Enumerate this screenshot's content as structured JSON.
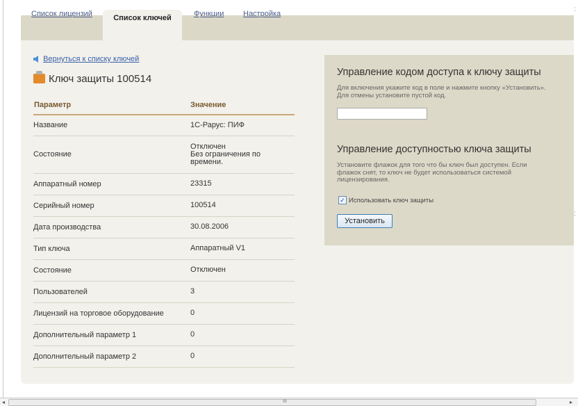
{
  "tabs": [
    {
      "label": "Список лицензий",
      "active": false
    },
    {
      "label": "Список ключей",
      "active": true
    },
    {
      "label": "Функции",
      "active": false
    },
    {
      "label": "Настройка",
      "active": false
    }
  ],
  "back_link": "Вернуться к списку ключей",
  "key_title": "Ключ защиты 100514",
  "table": {
    "headers": [
      "Параметр",
      "Значение"
    ],
    "rows": [
      [
        "Название",
        "1С-Рарус: ПИФ"
      ],
      [
        "Состояние",
        "Отключен\nБез ограничения по\nвремени."
      ],
      [
        "Аппаратный номер",
        "23315"
      ],
      [
        "Серийный номер",
        "100514"
      ],
      [
        "Дата производства",
        "30.08.2006"
      ],
      [
        "Тип ключа",
        "Аппаратный V1"
      ],
      [
        "Состояние",
        "Отключен"
      ],
      [
        "Пользователей",
        "3"
      ],
      [
        "Лицензий на торговое оборудование",
        "0"
      ],
      [
        "Дополнительный параметр 1",
        "0"
      ],
      [
        "Дополнительный параметр 2",
        "0"
      ]
    ]
  },
  "access_code": {
    "title": "Управление кодом доступа к ключу защиты",
    "note": "Для включения укажите код в поле и нажмите кнопку «Установить». Для отмены установите пустой код.",
    "value": ""
  },
  "availability": {
    "title": "Управление доступностью ключа защиты",
    "note": "Установите флажок для того что бы ключ был доступен. Если флажок снят, то ключ не будет использоваться системой лицензирования.",
    "checkbox_label": "Использовать ключ защиты",
    "checked": true
  },
  "button_label": "Установить",
  "scrollbar": {
    "grip": "III",
    "left_arrow": "◂",
    "right_arrow": "▸"
  },
  "colors": {
    "tabbar": "#dcd8c8",
    "panel": "#ddd9c8",
    "link": "#3a5fa8",
    "header_text": "#7a5a2e"
  }
}
